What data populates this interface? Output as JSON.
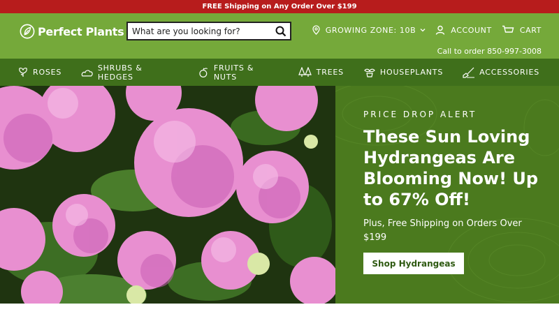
{
  "announcement": "FREE Shipping on Any Order Over $199",
  "brand": {
    "name": "Perfect Plants"
  },
  "search": {
    "placeholder": "What are you looking for?"
  },
  "header": {
    "growing_zone": "GROWING ZONE: 10B",
    "account": "ACCOUNT",
    "cart": "CART",
    "call_to_order": "Call to order 850-997-3008"
  },
  "nav": {
    "items": [
      {
        "label": "ROSES",
        "icon": "rose-icon"
      },
      {
        "label": "SHRUBS & HEDGES",
        "icon": "shrub-icon"
      },
      {
        "label": "FRUITS & NUTS",
        "icon": "fruit-icon"
      },
      {
        "label": "TREES",
        "icon": "trees-icon"
      },
      {
        "label": "HOUSEPLANTS",
        "icon": "houseplant-icon"
      },
      {
        "label": "ACCESSORIES",
        "icon": "shovel-icon"
      }
    ]
  },
  "hero": {
    "eyebrow": "PRICE DROP ALERT",
    "title": "These Sun Loving Hydrangeas Are Blooming Now! Up to 67% Off!",
    "subtitle": "Plus, Free Shipping on Orders Over $199",
    "button": "Shop Hydrangeas"
  },
  "colors": {
    "announcement_bg": "#b71c1c",
    "header_bg": "#75a93a",
    "nav_bg": "#3f6f1b",
    "hero_panel_bg": "#4b7a1e"
  }
}
